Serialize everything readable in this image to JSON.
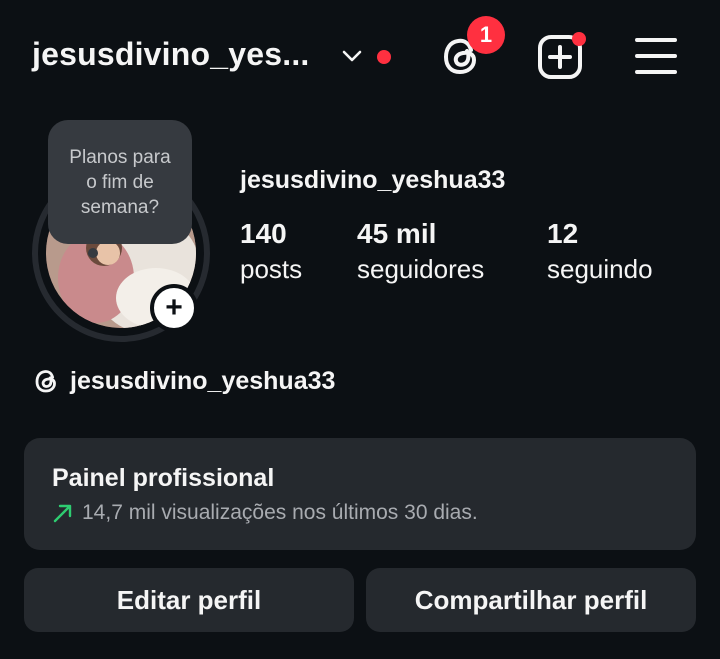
{
  "header": {
    "username": "jesusdivino_yes...",
    "threads_badge_count": "1",
    "icons": [
      "chevron-down-icon",
      "threads-icon",
      "create-post-icon",
      "menu-icon"
    ],
    "notification_dot_color": "#ff3040"
  },
  "note": {
    "text": "Planos para o fim de semana?"
  },
  "profile": {
    "handle": "jesusdivino_yeshua33",
    "stats": [
      {
        "value": "140",
        "label": "posts"
      },
      {
        "value": "45 mil",
        "label": "seguidores"
      },
      {
        "value": "12",
        "label": "seguindo"
      }
    ],
    "add_story_symbol": "+",
    "threads_link": "jesusdivino_yeshua33"
  },
  "pro_panel": {
    "title": "Painel profissional",
    "subtitle": "14,7 mil visualizações nos últimos 30 dias.",
    "trend_color": "#2ecc71"
  },
  "buttons": {
    "edit": "Editar perfil",
    "share": "Compartilhar perfil"
  },
  "colors": {
    "background": "#0c1014",
    "card": "#25292e",
    "text": "#f5f5f5",
    "muted": "#a8abb0"
  }
}
